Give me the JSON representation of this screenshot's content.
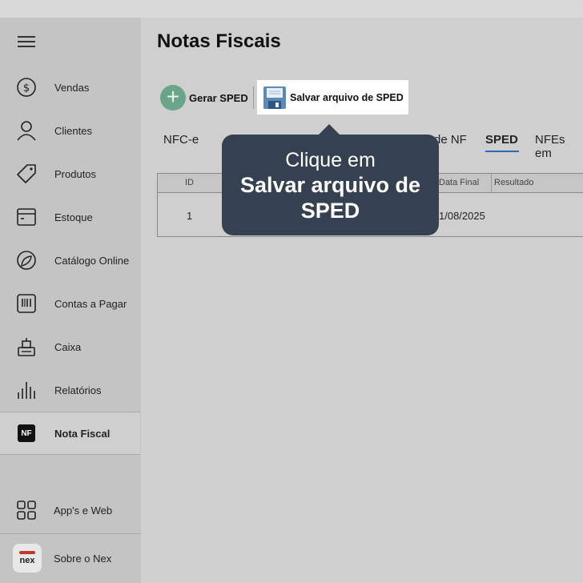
{
  "sidebar": {
    "items": [
      {
        "label": "Vendas",
        "icon": "dollar-circle-icon"
      },
      {
        "label": "Clientes",
        "icon": "person-icon"
      },
      {
        "label": "Produtos",
        "icon": "tag-icon"
      },
      {
        "label": "Estoque",
        "icon": "box-icon"
      },
      {
        "label": "Catálogo Online",
        "icon": "leaf-circle-icon"
      },
      {
        "label": "Contas a Pagar",
        "icon": "barcode-icon"
      },
      {
        "label": "Caixa",
        "icon": "register-icon"
      },
      {
        "label": "Relatórios",
        "icon": "bars-icon"
      },
      {
        "label": "Nota Fiscal",
        "icon": "nf-icon",
        "badge": "NF"
      }
    ],
    "apps_label": "App's e Web",
    "about_label": "Sobre o Nex",
    "logo_text": "nex"
  },
  "page": {
    "title": "Notas Fiscais"
  },
  "toolbar": {
    "gerar_label": "Gerar SPED",
    "salvar_label": "Salvar arquivo de SPED"
  },
  "tabs": [
    "NFC-e",
    "de NF",
    "SPED",
    "NFEs em"
  ],
  "table": {
    "headers": [
      "ID",
      "Data Final",
      "Resultado"
    ],
    "rows": [
      {
        "id": "1",
        "data_final": "1/08/2025"
      }
    ]
  },
  "tooltip": {
    "line1": "Clique em",
    "line2": "Salvar arquivo de",
    "line3": "SPED"
  },
  "colors": {
    "accent": "#2e6ab0",
    "tooltip_bg": "#354150",
    "plus": "#6aa58a",
    "brand": "#c0392b"
  }
}
